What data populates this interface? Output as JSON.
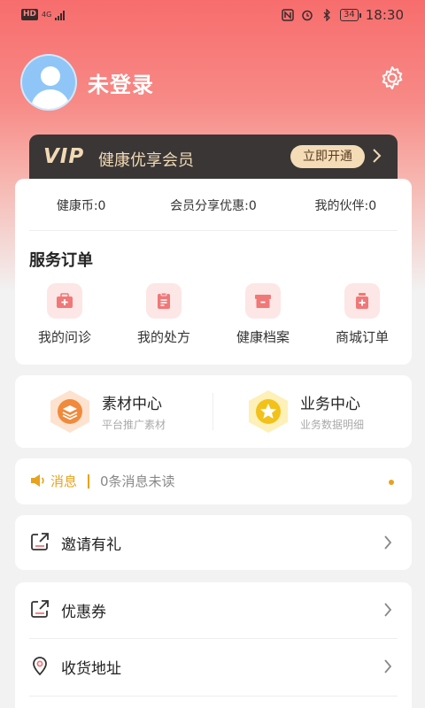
{
  "status_bar": {
    "hd": "HD",
    "network": "4G",
    "time": "18:30",
    "battery": "34"
  },
  "profile": {
    "username": "未登录"
  },
  "vip": {
    "logo": "VIP",
    "title": "健康优享会员",
    "button": "立即开通"
  },
  "stats": [
    {
      "label": "健康币:0"
    },
    {
      "label": "会员分享优惠:0"
    },
    {
      "label": "我的伙伴:0"
    }
  ],
  "service_orders": {
    "title": "服务订单",
    "items": [
      {
        "label": "我的问诊",
        "icon": "medical-kit-icon"
      },
      {
        "label": "我的处方",
        "icon": "prescription-icon"
      },
      {
        "label": "健康档案",
        "icon": "archive-box-icon"
      },
      {
        "label": "商城订单",
        "icon": "medicine-bottle-icon"
      }
    ]
  },
  "centers": [
    {
      "title": "素材中心",
      "subtitle": "平台推广素材",
      "icon": "layers-icon",
      "color": "#f08a3c"
    },
    {
      "title": "业务中心",
      "subtitle": "业务数据明细",
      "icon": "star-icon",
      "color": "#f2c21a"
    }
  ],
  "message": {
    "label": "消息",
    "text": "0条消息未读",
    "accent": "#e8a21c"
  },
  "menu": {
    "invite": "邀请有礼",
    "coupon": "优惠券",
    "address": "收货地址"
  },
  "colors": {
    "hero": "#f76d6d",
    "vip_bg": "#3a3636",
    "vip_gold": "#f0d9b4"
  }
}
